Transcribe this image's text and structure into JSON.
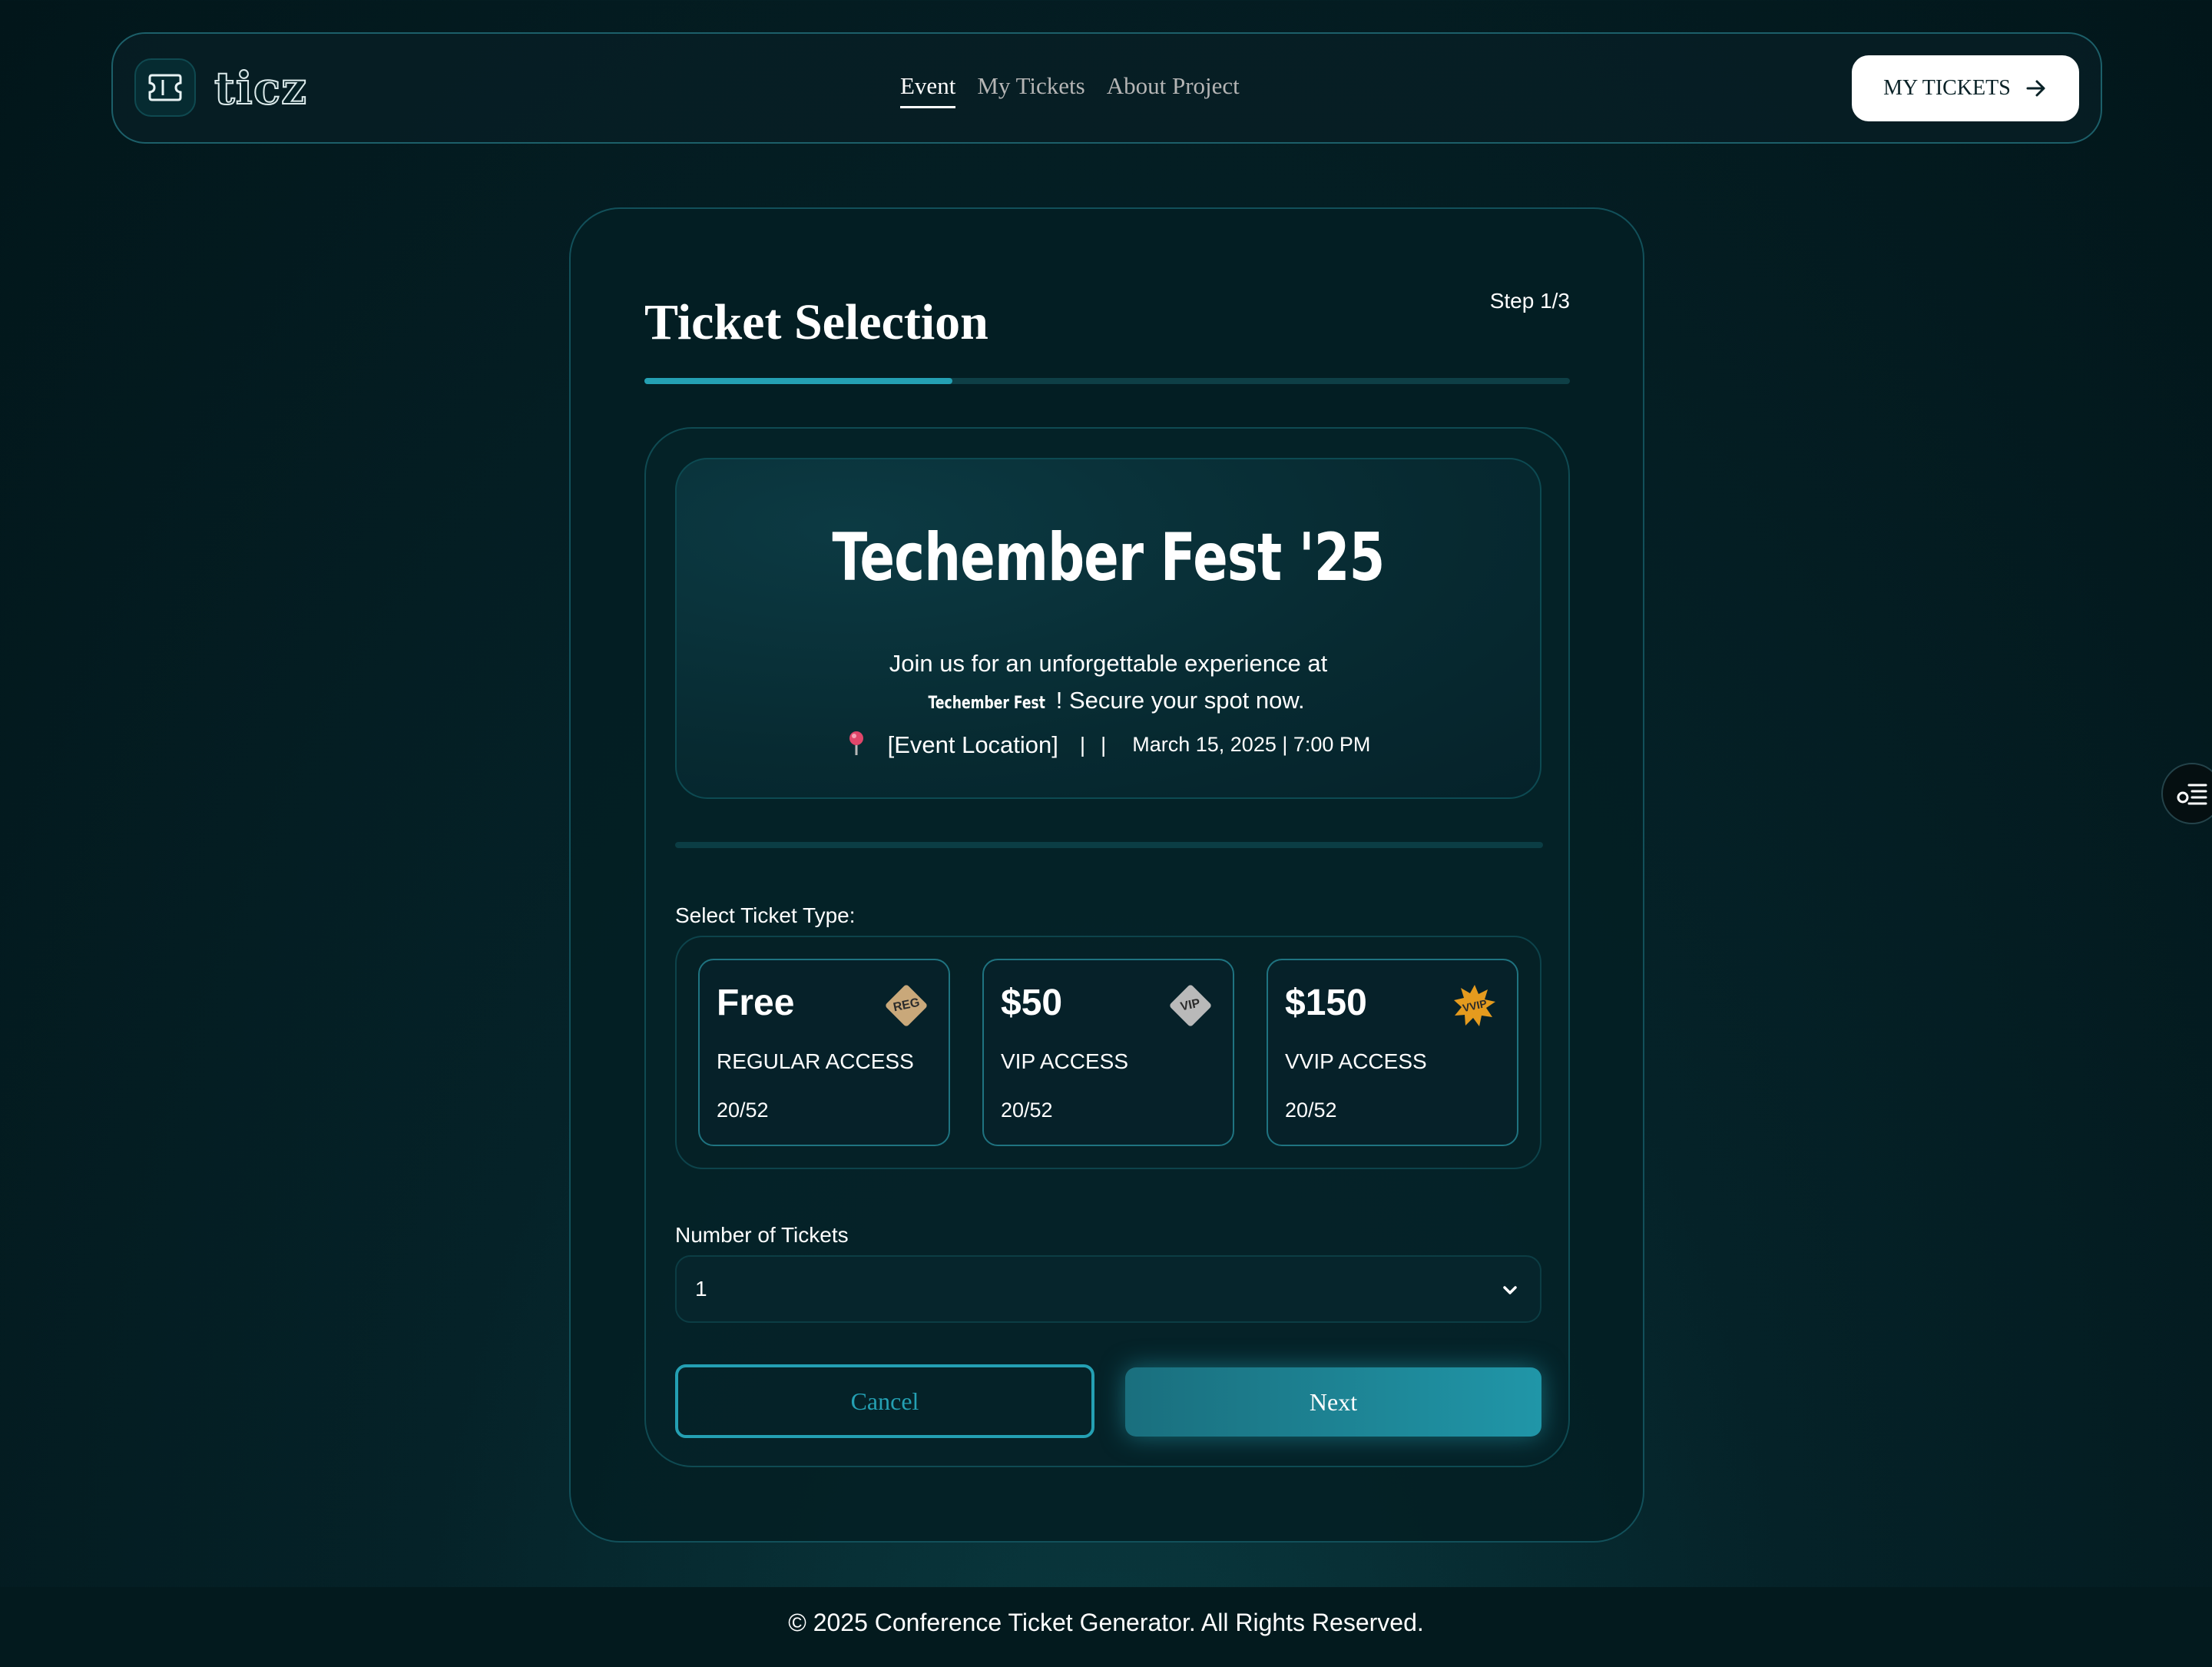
{
  "header": {
    "logo_text": "ticz",
    "nav": [
      {
        "label": "Event",
        "active": true
      },
      {
        "label": "My Tickets",
        "active": false
      },
      {
        "label": "About Project",
        "active": false
      }
    ],
    "cta_label": "MY TICKETS"
  },
  "card": {
    "title": "Ticket Selection",
    "step": "Step 1/3",
    "progress": 0.333
  },
  "event": {
    "title": "Techember Fest '25",
    "desc_before": "Join us for an unforgettable experience at",
    "desc_brand": "Techember Fest",
    "desc_after": "! Secure your spot now.",
    "location": "[Event Location]",
    "separator": "| |",
    "datetime": "March 15, 2025 | 7:00 PM"
  },
  "ticket_type_label": "Select Ticket Type:",
  "ticket_types": [
    {
      "price": "Free",
      "name": "REGULAR ACCESS",
      "count": "20/52",
      "badge": "REG",
      "badge_color": "#c9a87a",
      "icon": "reg-badge-icon"
    },
    {
      "price": "$50",
      "name": "VIP ACCESS",
      "count": "20/52",
      "badge": "VIP",
      "badge_color": "#b9b9b9",
      "icon": "vip-badge-icon"
    },
    {
      "price": "$150",
      "name": "VVIP ACCESS",
      "count": "20/52",
      "badge": "VVIP",
      "badge_color": "#e59b1e",
      "icon": "vvip-badge-icon"
    }
  ],
  "quantity": {
    "label": "Number of Tickets",
    "value": "1"
  },
  "buttons": {
    "cancel": "Cancel",
    "next": "Next"
  },
  "footer": {
    "text": "© 2025 Conference Ticket Generator. All Rights Reserved."
  },
  "colors": {
    "accent": "#24a0b3",
    "background": "#02161a",
    "card_border": "#12505a"
  }
}
